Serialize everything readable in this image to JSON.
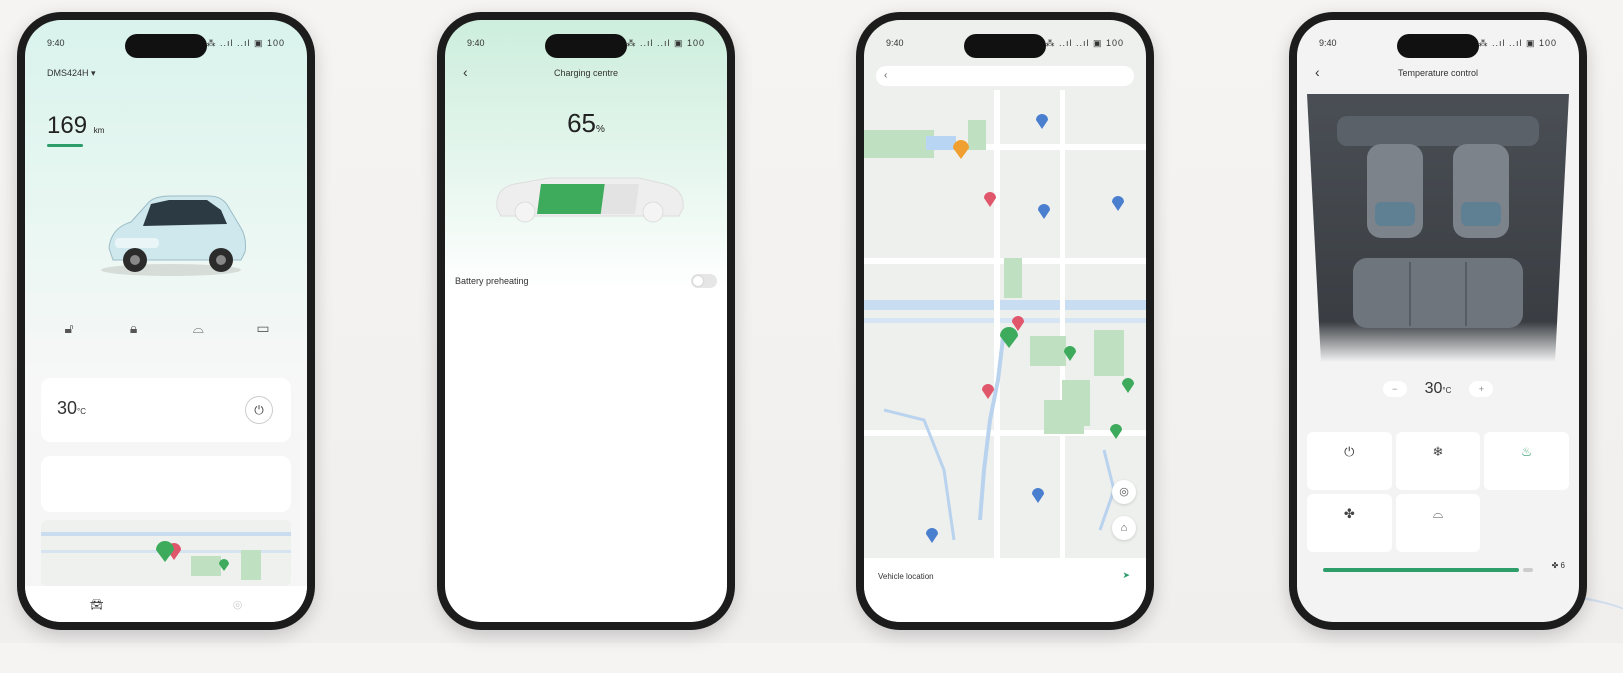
{
  "phones": [
    {
      "status": {
        "time": "9:40",
        "icons": "◎ ⁂ ..ıl ..ıl ▣ 100"
      },
      "car": {
        "name": "DMS424H ▾",
        "subtitle": "",
        "range_value": "169",
        "range_unit": "km",
        "range_label": "",
        "door_status": "",
        "parked_text": ""
      },
      "controls": [
        {
          "label": "",
          "icon": "unlock-icon"
        },
        {
          "label": "",
          "icon": "lock-icon"
        },
        {
          "label": "",
          "icon": "trunk-icon"
        },
        {
          "label": "",
          "icon": "window-icon"
        }
      ],
      "temp": {
        "value": "30",
        "unit": "°C"
      },
      "nearby": {
        "heading": "",
        "button": ""
      },
      "nav": [
        {
          "label": ""
        },
        {
          "label": ""
        }
      ]
    },
    {
      "status": {
        "time": "9:40",
        "icons": "⁂ ..ıl ..ıl ▣ 100"
      },
      "title": "Charging centre",
      "percent": "65",
      "percent_unit": "%",
      "charge_level": 0.65,
      "battery_preheat": {
        "title": "Battery preheating",
        "description": "",
        "enabled": false
      }
    },
    {
      "status": {
        "time": "9:40",
        "icons": "⁂ ..ıl ..ıl ▣ 100"
      },
      "search_placeholder": "",
      "map_labels": [],
      "location": {
        "title": "Vehicle location",
        "time": "",
        "address": ""
      }
    },
    {
      "status": {
        "time": "9:40",
        "icons": "⁂ ..ıl ..ıl ▣ 100"
      },
      "title": "Temperature control",
      "temp": {
        "value": "30",
        "unit": "°C"
      },
      "modes": [
        {
          "label": "",
          "icon": "power-icon",
          "active": false
        },
        {
          "label": "",
          "icon": "snowflake-icon",
          "active": false
        },
        {
          "label": "",
          "icon": "seat-heat-icon",
          "active": true
        },
        {
          "label": "",
          "icon": "fan-icon",
          "active": false
        },
        {
          "label": "",
          "icon": "windshield-icon",
          "active": false
        }
      ],
      "fan_level": "6",
      "schedule_link": ""
    }
  ],
  "colors": {
    "accent": "#2d9d6a",
    "pin_red": "#e0566b",
    "pin_green": "#3daa5c",
    "pin_blue": "#4a7fd0",
    "pin_orange": "#f0a030"
  }
}
